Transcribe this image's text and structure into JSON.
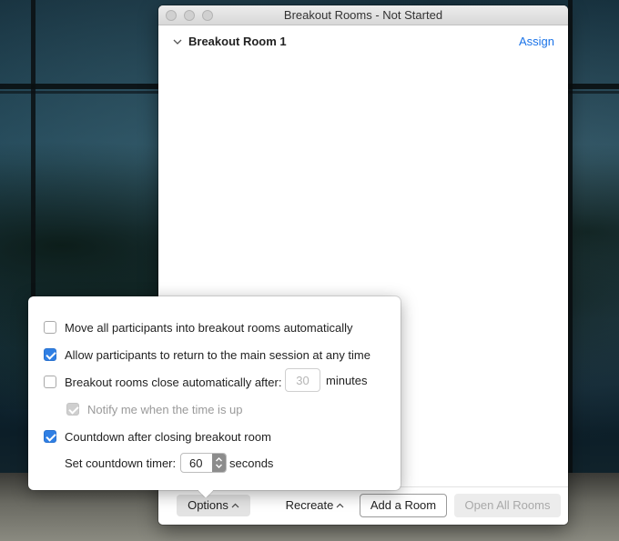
{
  "window": {
    "title": "Breakout Rooms - Not Started"
  },
  "rooms": [
    {
      "name": "Breakout Room 1",
      "action_label": "Assign"
    }
  ],
  "footer": {
    "options_label": "Options",
    "recreate_label": "Recreate",
    "add_room_label": "Add a Room",
    "open_all_label": "Open All Rooms"
  },
  "options": {
    "move_auto": {
      "label": "Move all participants into breakout rooms automatically",
      "checked": false
    },
    "allow_return": {
      "label": "Allow participants to return to the main session at any time",
      "checked": true
    },
    "auto_close": {
      "label": "Breakout rooms close automatically after:",
      "checked": false,
      "value": "30",
      "unit": "minutes"
    },
    "notify": {
      "label": "Notify me when the time is up",
      "checked": true,
      "disabled": true
    },
    "countdown": {
      "label": "Countdown after closing breakout room",
      "checked": true
    },
    "timer": {
      "label": "Set countdown timer:",
      "value": "60",
      "unit": "seconds"
    }
  },
  "colors": {
    "accent": "#2f7fe4",
    "link": "#1a73e8"
  }
}
